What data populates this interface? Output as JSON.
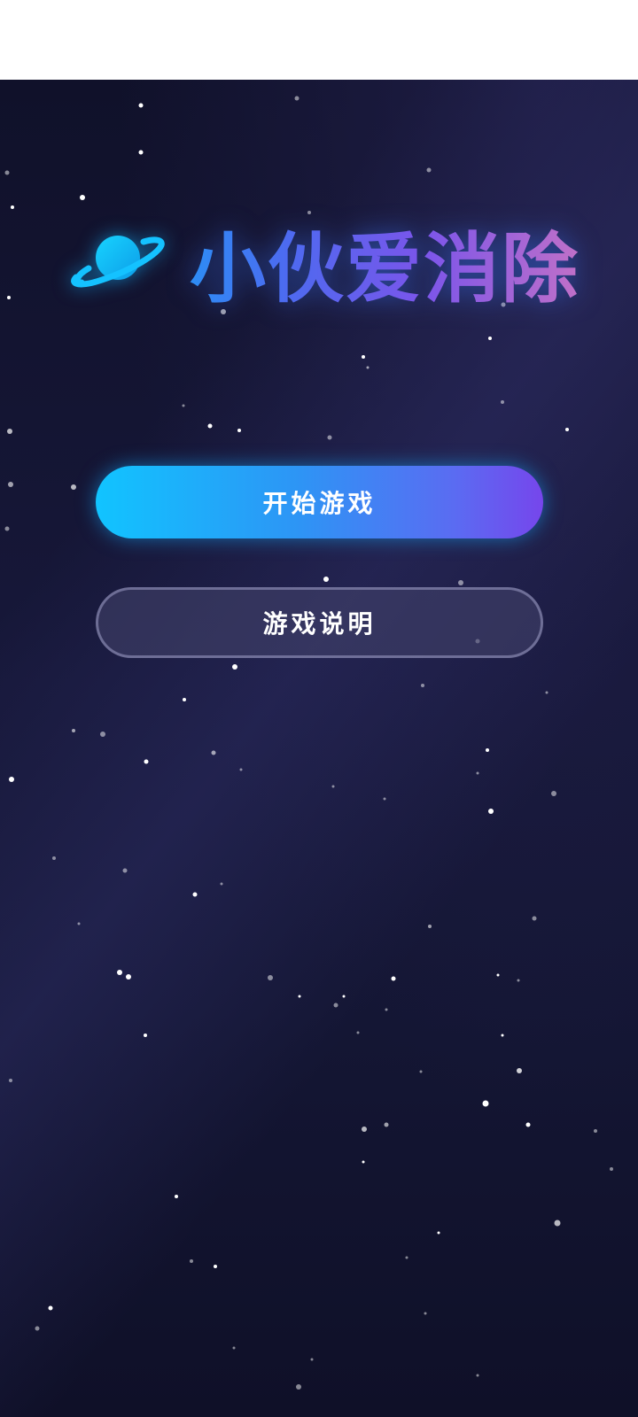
{
  "title": "小伙爱消除",
  "icons": {
    "logo": "planet-icon"
  },
  "buttons": {
    "start_label": "开始游戏",
    "help_label": "游戏说明"
  },
  "colors": {
    "background": "#141634",
    "start_button_from": "#11c4ff",
    "start_button_to": "#7646ec",
    "title_from": "#2d8df5",
    "title_to": "#c070c8"
  }
}
